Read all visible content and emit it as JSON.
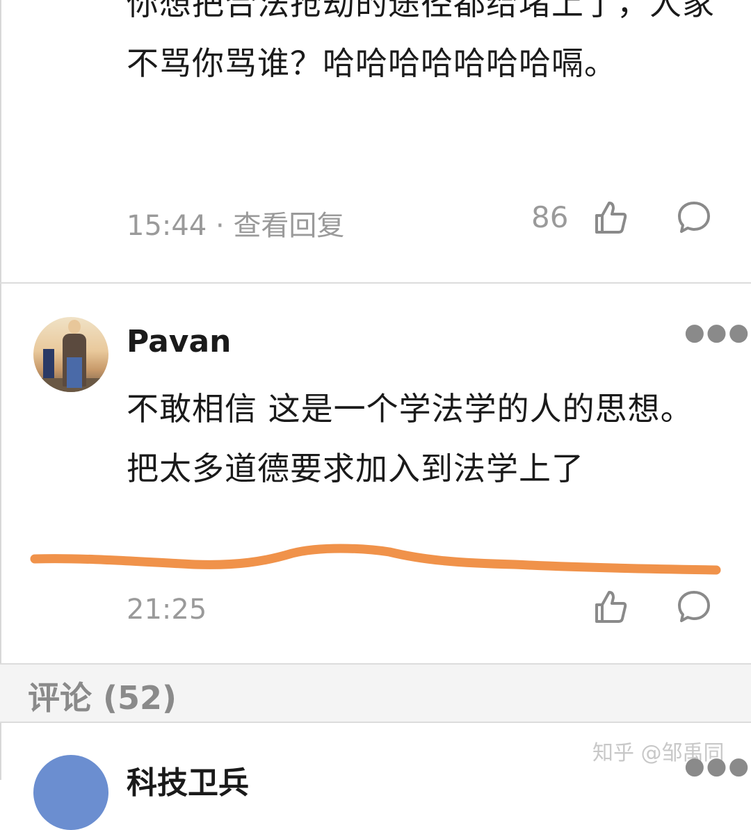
{
  "comment_prev": {
    "text": "你想把合法抢劫的途径都给堵上了，人家不骂你骂谁？哈哈哈哈哈哈哈嗝。",
    "time": "15:44",
    "view_replies": "查看回复",
    "like_count": "86"
  },
  "comment_main": {
    "username": "Pavan",
    "text": "不敢相信 这是一个学法学的人的思想。把太多道德要求加入到法学上了",
    "time": "21:25",
    "annotation_color": "#F0924A"
  },
  "comments_header": {
    "label": "评论 (52)"
  },
  "comment_next": {
    "username": "科技卫兵"
  },
  "watermark": "知乎 @邹禹同",
  "icons": {
    "like": "thumbs-up-icon",
    "reply": "speech-bubble-icon",
    "more": "more-dots-icon"
  }
}
